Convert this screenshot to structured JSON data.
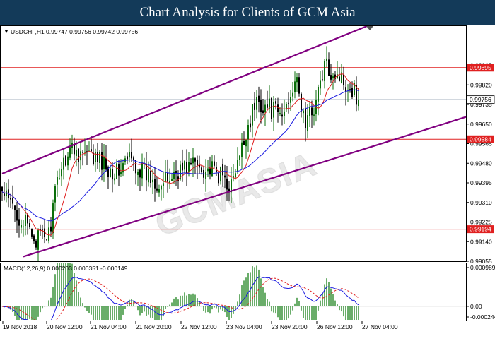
{
  "header": {
    "title": "Chart Analysis for Clients of GCM Asia"
  },
  "chart_data": [
    {
      "type": "candlestick",
      "info_label": "USDCHF,H1  0.99747 0.99756 0.99742 0.99756",
      "symbol": "USDCHF,H1",
      "ohlc_last": {
        "open": 0.99747,
        "high": 0.99756,
        "low": 0.99742,
        "close": 0.99756
      },
      "ylim": [
        0.99055,
        1.00075
      ],
      "yticks": [
        0.99905,
        0.9982,
        0.99735,
        0.9965,
        0.99565,
        0.9948,
        0.99395,
        0.9931,
        0.99225,
        0.9914,
        0.99055
      ],
      "ytick_labels": [
        "0.99905",
        "0.99820",
        "0.99735",
        "0.99650",
        "0.99565",
        "0.99480",
        "0.99395",
        "0.99310",
        "0.99225",
        "0.99140",
        "0.99055"
      ],
      "current_price": "0.99756",
      "horizontal_levels": [
        {
          "value": 0.99895,
          "label": "0.99895",
          "color": "#e02020"
        },
        {
          "value": 0.99584,
          "label": "0.99584",
          "color": "#e02020"
        },
        {
          "value": 0.99194,
          "label": "0.99194",
          "color": "#e02020"
        }
      ],
      "channel_lines": [
        {
          "name": "upper-channel",
          "from": {
            "bar": 0,
            "price": 0.99435
          },
          "to": {
            "bar": 172,
            "price": 1.00075
          },
          "color": "#800080"
        },
        {
          "name": "lower-channel",
          "from": {
            "bar": 10,
            "price": 0.99075
          },
          "to": {
            "bar": 220,
            "price": 0.99685
          },
          "color": "#800080"
        }
      ],
      "moving_averages": [
        {
          "name": "fast-ma",
          "color": "#e02020"
        },
        {
          "name": "slow-ma",
          "color": "#1a1ae0"
        }
      ],
      "x_labels": [
        "19 Nov 2018",
        "20 Nov 12:00",
        "21 Nov 04:00",
        "21 Nov 20:00",
        "22 Nov 12:00",
        "23 Nov 04:00",
        "23 Nov 20:00",
        "26 Nov 12:00",
        "27 Nov 04:00"
      ],
      "anchors": [
        [
          0,
          0.9935
        ],
        [
          8,
          0.9925
        ],
        [
          16,
          0.9915
        ],
        [
          22,
          0.9917
        ],
        [
          27,
          0.9945
        ],
        [
          32,
          0.9955
        ],
        [
          40,
          0.9951
        ],
        [
          46,
          0.9949
        ],
        [
          54,
          0.9944
        ],
        [
          60,
          0.995
        ],
        [
          68,
          0.9943
        ],
        [
          76,
          0.9939
        ],
        [
          82,
          0.9944
        ],
        [
          90,
          0.9948
        ],
        [
          98,
          0.9945
        ],
        [
          104,
          0.9942
        ],
        [
          108,
          0.9938
        ],
        [
          112,
          0.995
        ],
        [
          116,
          0.9965
        ],
        [
          120,
          0.9975
        ],
        [
          126,
          0.9972
        ],
        [
          132,
          0.9968
        ],
        [
          138,
          0.9985
        ],
        [
          143,
          0.9965
        ],
        [
          148,
          0.9975
        ],
        [
          152,
          0.999
        ],
        [
          158,
          0.9987
        ],
        [
          162,
          0.9983
        ],
        [
          166,
          0.998
        ],
        [
          168,
          0.99756
        ]
      ],
      "colors": {
        "up": "#0a6e0a",
        "down": "#000000",
        "levels": "#e02020",
        "channel": "#800080",
        "price_line": "#8899aa"
      }
    },
    {
      "type": "macd",
      "title": "MACD(12,26,9) 0.000203 0.000351 -0.000149",
      "params": [
        12,
        26,
        9
      ],
      "values": {
        "macd": 0.000203,
        "signal": 0.000351,
        "histogram": -0.000149
      },
      "yticks": [
        0.000989,
        0.0,
        -0.000244
      ],
      "ytick_labels": [
        "0.000989",
        "0.00",
        "-0.000244"
      ],
      "colors": {
        "macd": "#1a1ae0",
        "signal": "#e02020",
        "histogram": "#2a8a2a"
      }
    }
  ]
}
